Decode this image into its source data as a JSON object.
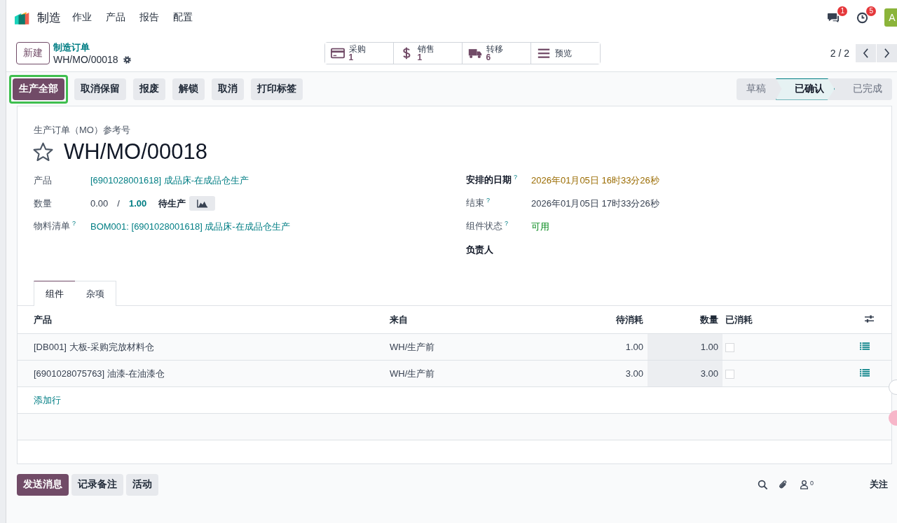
{
  "app": {
    "name": "制造",
    "menu": [
      "作业",
      "产品",
      "报告",
      "配置"
    ]
  },
  "systray": [
    {
      "kind": "chat",
      "count": "1"
    },
    {
      "kind": "activity",
      "count": "5"
    }
  ],
  "avatar": "A",
  "control_panel": {
    "new_button": "新建",
    "breadcrumb": "制造订单",
    "record": "WH/MO/00018",
    "pager": "2 / 2"
  },
  "smart_buttons": [
    {
      "kind": "purchase",
      "label": "采购",
      "count": "1"
    },
    {
      "kind": "sale",
      "label": "销售",
      "count": "1"
    },
    {
      "kind": "transfer",
      "label": "转移",
      "count": "6"
    },
    {
      "kind": "overview",
      "label": "预览"
    }
  ],
  "actions": [
    {
      "label": "生产全部",
      "primary": true,
      "highlighted": true
    },
    {
      "label": "取消保留",
      "primary": false,
      "highlighted": false
    },
    {
      "label": "报废",
      "primary": false,
      "highlighted": false
    },
    {
      "label": "解锁",
      "primary": false,
      "highlighted": false
    },
    {
      "label": "取消",
      "primary": false,
      "highlighted": false
    },
    {
      "label": "打印标签",
      "primary": false,
      "highlighted": false
    }
  ],
  "status_steps": [
    {
      "label": "草稿",
      "selected": false
    },
    {
      "label": "已确认",
      "selected": true
    },
    {
      "label": "已完成",
      "selected": false
    }
  ],
  "form": {
    "reference_label": "生产订单（MO）参考号",
    "title": "WH/MO/00018",
    "starred": false,
    "left_fields": [
      {
        "label": "产品",
        "kind": "link",
        "value": "[6901028001618] 成品床-在成品仓生产"
      },
      {
        "label": "数量",
        "kind": "quantity",
        "produced": "0.00",
        "separator": "/",
        "planned": "1.00",
        "unit": "待生产"
      },
      {
        "label": "物料清单",
        "help": "?",
        "kind": "link",
        "value": "BOM001: [6901028001618] 成品床-在成品仓生产"
      }
    ],
    "right_fields": [
      {
        "label": "安排的日期",
        "help": "?",
        "bold": true,
        "kind": "warning",
        "value": "2026年01月05日 16时33分26秒"
      },
      {
        "label": "结束",
        "help": "?",
        "bold": false,
        "kind": "text",
        "value": "2026年01月05日 17时33分26秒"
      },
      {
        "label": "组件状态",
        "help": "?",
        "bold": false,
        "kind": "success",
        "value": "可用"
      },
      {
        "label": "负责人",
        "bold": true
      }
    ]
  },
  "tabs": [
    {
      "label": "组件",
      "selected": true
    },
    {
      "label": "杂项",
      "selected": false
    }
  ],
  "table": {
    "columns": [
      "产品",
      "来自",
      "待消耗",
      "数量",
      "已消耗"
    ],
    "rows": [
      {
        "product": "[DB001] 大板-采购完放材料仓",
        "from": "WH/生产前",
        "to_consume": "1.00",
        "quantity": "1.00",
        "consumed": false
      },
      {
        "product": "[6901028075763] 油漆-在油漆仓",
        "from": "WH/生产前",
        "to_consume": "3.00",
        "quantity": "3.00",
        "consumed": false
      }
    ],
    "add_line": "添加行"
  },
  "chatter": {
    "buttons": [
      {
        "label": "发送消息",
        "primary": true
      },
      {
        "label": "记录备注",
        "primary": false
      },
      {
        "label": "活动",
        "primary": false
      }
    ],
    "followers_count": "0",
    "follow": "关注"
  }
}
